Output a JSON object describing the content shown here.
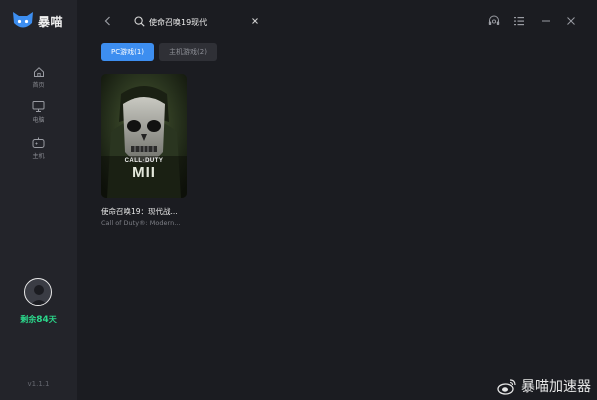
{
  "app": {
    "name": "暴喵",
    "version": "v1.1.1",
    "remaining_prefix": "剩余",
    "remaining_days": "84",
    "remaining_suffix": "天"
  },
  "sidebar": {
    "items": [
      {
        "label": "首页",
        "icon": "home-icon"
      },
      {
        "label": "电脑",
        "icon": "monitor-icon"
      },
      {
        "label": "主机",
        "icon": "gamepad-icon"
      }
    ]
  },
  "search": {
    "value": "使命召唤19现代"
  },
  "tabs": [
    {
      "label": "PC游戏(1)",
      "active": true
    },
    {
      "label": "主机游戏(2)",
      "active": false
    }
  ],
  "results": [
    {
      "title": "使命召唤19：现代战...",
      "subtitle": "Call of Duty®: Modern...",
      "cover_line1": "CALL·DUTY",
      "cover_line2": "MII"
    }
  ],
  "watermark": {
    "text": "暴喵加速器"
  },
  "colors": {
    "accent": "#3d8ef0",
    "remaining": "#2bd98c",
    "sidebar_bg": "#23242a",
    "main_bg": "#1b1c21"
  }
}
